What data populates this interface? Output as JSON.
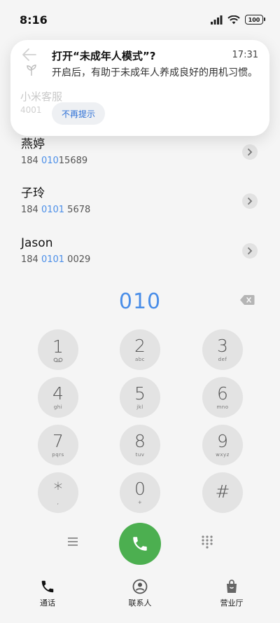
{
  "status_bar": {
    "time": "8:16",
    "battery": "100"
  },
  "notification": {
    "title": "打开“未成年人模式”?",
    "time": "17:31",
    "body": "开启后，有助于未成年人养成良好的用机习惯。",
    "dismiss_label": "不再提示",
    "behind_name": "小米客服",
    "behind_number": "4001"
  },
  "contacts": [
    {
      "name": "燕婷",
      "number_prefix": "184 ",
      "number_match": "010",
      "number_rest": "15689"
    },
    {
      "name": "子玲",
      "number_prefix": "184 ",
      "number_match": "0101",
      "number_rest": " 5678"
    },
    {
      "name": "Jason",
      "number_prefix": "184 ",
      "number_match": "0101",
      "number_rest": " 0029"
    }
  ],
  "dial": {
    "number": "010"
  },
  "keypad": [
    {
      "digit": "1",
      "letters": "voicemail"
    },
    {
      "digit": "2",
      "letters": "abc"
    },
    {
      "digit": "3",
      "letters": "def"
    },
    {
      "digit": "4",
      "letters": "ghi"
    },
    {
      "digit": "5",
      "letters": "jkl"
    },
    {
      "digit": "6",
      "letters": "mno"
    },
    {
      "digit": "7",
      "letters": "pqrs"
    },
    {
      "digit": "8",
      "letters": "tuv"
    },
    {
      "digit": "9",
      "letters": "wxyz"
    },
    {
      "digit": "*",
      "letters": ","
    },
    {
      "digit": "0",
      "letters": "+"
    },
    {
      "digit": "#",
      "letters": ""
    }
  ],
  "bottom_nav": [
    {
      "label": "通话",
      "icon": "phone-icon"
    },
    {
      "label": "联系人",
      "icon": "person-icon"
    },
    {
      "label": "营业厅",
      "icon": "shopping-bag-icon"
    }
  ],
  "colors": {
    "accent": "#4a8ee8",
    "call": "#4caf50",
    "key": "#e3e3e3"
  }
}
